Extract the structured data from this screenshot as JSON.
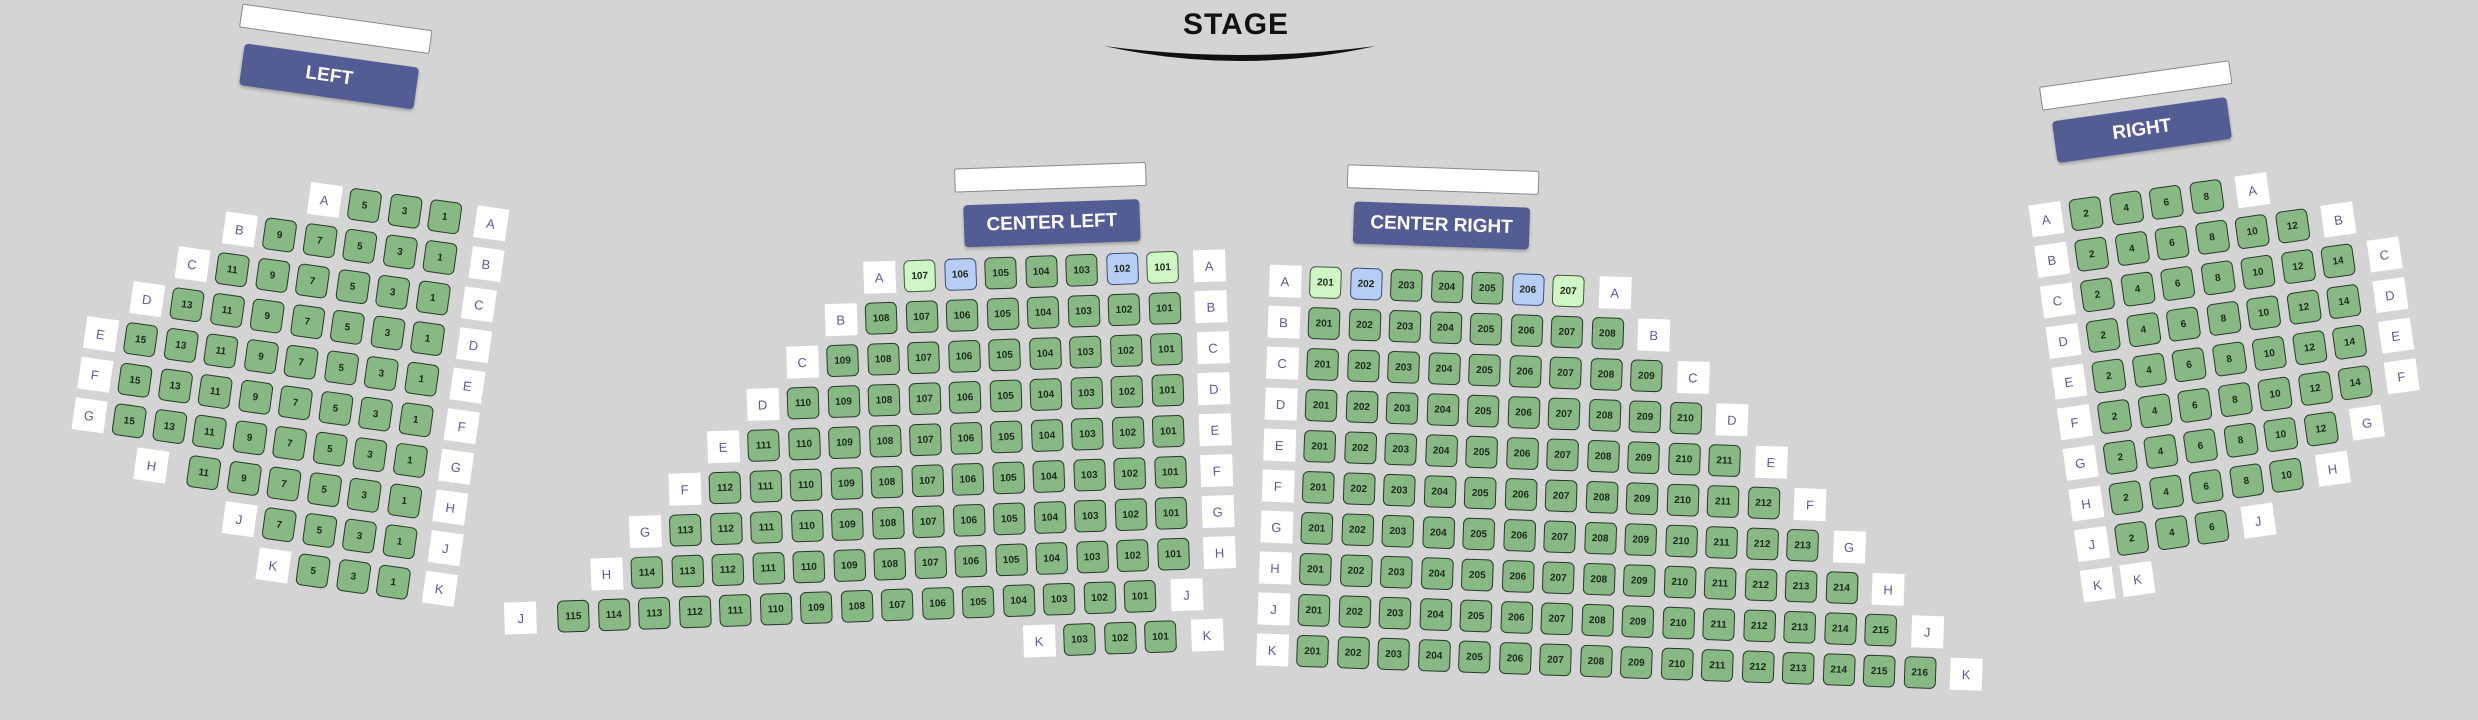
{
  "stage": {
    "title": "STAGE"
  },
  "colors": {
    "background": "#d4d4d4",
    "seat_available": "#88b984",
    "seat_selected": "#b7cdf3",
    "seat_held": "#cff6c4",
    "banner": "#545c94",
    "row_label_text": "#5b5b9b"
  },
  "seat_legend_states": [
    "available",
    "selected",
    "held"
  ],
  "sections": [
    {
      "id": "left",
      "name": "LEFT",
      "rows": [
        {
          "label": "A",
          "seats": [
            "5",
            "3",
            "1"
          ]
        },
        {
          "label": "B",
          "seats": [
            "9",
            "7",
            "5",
            "3",
            "1"
          ]
        },
        {
          "label": "C",
          "seats": [
            "11",
            "9",
            "7",
            "5",
            "3",
            "1"
          ]
        },
        {
          "label": "D",
          "seats": [
            "13",
            "11",
            "9",
            "7",
            "5",
            "3",
            "1"
          ]
        },
        {
          "label": "E",
          "seats": [
            "15",
            "13",
            "11",
            "9",
            "7",
            "5",
            "3",
            "1"
          ]
        },
        {
          "label": "F",
          "seats": [
            "15",
            "13",
            "11",
            "9",
            "7",
            "5",
            "3",
            "1"
          ]
        },
        {
          "label": "G",
          "seats": [
            "15",
            "13",
            "11",
            "9",
            "7",
            "5",
            "3",
            "1"
          ]
        },
        {
          "label": "H",
          "seats": [
            "11",
            "9",
            "7",
            "5",
            "3",
            "1"
          ]
        },
        {
          "label": "J",
          "seats": [
            "7",
            "5",
            "3",
            "1"
          ]
        },
        {
          "label": "K",
          "seats": [
            "5",
            "3",
            "1"
          ]
        }
      ]
    },
    {
      "id": "center-left",
      "name": "CENTER LEFT",
      "rows": [
        {
          "label": "A",
          "seats": [
            "107",
            "106",
            "105",
            "104",
            "103",
            "102",
            "101"
          ],
          "states": {
            "107": "held",
            "106": "selected",
            "102": "selected",
            "101": "held"
          }
        },
        {
          "label": "B",
          "seats": [
            "108",
            "107",
            "106",
            "105",
            "104",
            "103",
            "102",
            "101"
          ]
        },
        {
          "label": "C",
          "seats": [
            "109",
            "108",
            "107",
            "106",
            "105",
            "104",
            "103",
            "102",
            "101"
          ]
        },
        {
          "label": "D",
          "seats": [
            "110",
            "109",
            "108",
            "107",
            "106",
            "105",
            "104",
            "103",
            "102",
            "101"
          ]
        },
        {
          "label": "E",
          "seats": [
            "111",
            "110",
            "109",
            "108",
            "107",
            "106",
            "105",
            "104",
            "103",
            "102",
            "101"
          ]
        },
        {
          "label": "F",
          "seats": [
            "112",
            "111",
            "110",
            "109",
            "108",
            "107",
            "106",
            "105",
            "104",
            "103",
            "102",
            "101"
          ]
        },
        {
          "label": "G",
          "seats": [
            "113",
            "112",
            "111",
            "110",
            "109",
            "108",
            "107",
            "106",
            "105",
            "104",
            "103",
            "102",
            "101"
          ]
        },
        {
          "label": "H",
          "seats": [
            "114",
            "113",
            "112",
            "111",
            "110",
            "109",
            "108",
            "107",
            "106",
            "105",
            "104",
            "103",
            "102",
            "101"
          ]
        },
        {
          "label": "J",
          "seats": [
            "115",
            "114",
            "113",
            "112",
            "111",
            "110",
            "109",
            "108",
            "107",
            "106",
            "105",
            "104",
            "103",
            "102",
            "101"
          ]
        },
        {
          "label": "K",
          "seats": [
            "103",
            "102",
            "101"
          ]
        }
      ]
    },
    {
      "id": "center-right",
      "name": "CENTER RIGHT",
      "rows": [
        {
          "label": "A",
          "seats": [
            "201",
            "202",
            "203",
            "204",
            "205",
            "206",
            "207"
          ],
          "states": {
            "201": "held",
            "202": "selected",
            "206": "selected",
            "207": "held"
          }
        },
        {
          "label": "B",
          "seats": [
            "201",
            "202",
            "203",
            "204",
            "205",
            "206",
            "207",
            "208"
          ]
        },
        {
          "label": "C",
          "seats": [
            "201",
            "202",
            "203",
            "204",
            "205",
            "206",
            "207",
            "208",
            "209"
          ]
        },
        {
          "label": "D",
          "seats": [
            "201",
            "202",
            "203",
            "204",
            "205",
            "206",
            "207",
            "208",
            "209",
            "210"
          ]
        },
        {
          "label": "E",
          "seats": [
            "201",
            "202",
            "203",
            "204",
            "205",
            "206",
            "207",
            "208",
            "209",
            "210",
            "211"
          ]
        },
        {
          "label": "F",
          "seats": [
            "201",
            "202",
            "203",
            "204",
            "205",
            "206",
            "207",
            "208",
            "209",
            "210",
            "211",
            "212"
          ]
        },
        {
          "label": "G",
          "seats": [
            "201",
            "202",
            "203",
            "204",
            "205",
            "206",
            "207",
            "208",
            "209",
            "210",
            "211",
            "212",
            "213"
          ]
        },
        {
          "label": "H",
          "seats": [
            "201",
            "202",
            "203",
            "204",
            "205",
            "206",
            "207",
            "208",
            "209",
            "210",
            "211",
            "212",
            "213",
            "214"
          ]
        },
        {
          "label": "J",
          "seats": [
            "201",
            "202",
            "203",
            "204",
            "205",
            "206",
            "207",
            "208",
            "209",
            "210",
            "211",
            "212",
            "213",
            "214",
            "215"
          ]
        },
        {
          "label": "K",
          "seats": [
            "201",
            "202",
            "203",
            "204",
            "205",
            "206",
            "207",
            "208",
            "209",
            "210",
            "211",
            "212",
            "213",
            "214",
            "215",
            "216"
          ]
        }
      ]
    },
    {
      "id": "right",
      "name": "RIGHT",
      "rows": [
        {
          "label": "A",
          "seats": [
            "2",
            "4",
            "6",
            "8"
          ]
        },
        {
          "label": "B",
          "seats": [
            "2",
            "4",
            "6",
            "8",
            "10",
            "12"
          ]
        },
        {
          "label": "C",
          "seats": [
            "2",
            "4",
            "6",
            "8",
            "10",
            "12",
            "14"
          ]
        },
        {
          "label": "D",
          "seats": [
            "2",
            "4",
            "6",
            "8",
            "10",
            "12",
            "14"
          ]
        },
        {
          "label": "E",
          "seats": [
            "2",
            "4",
            "6",
            "8",
            "10",
            "12",
            "14"
          ]
        },
        {
          "label": "F",
          "seats": [
            "2",
            "4",
            "6",
            "8",
            "10",
            "12",
            "14"
          ]
        },
        {
          "label": "G",
          "seats": [
            "2",
            "4",
            "6",
            "8",
            "10",
            "12"
          ]
        },
        {
          "label": "H",
          "seats": [
            "2",
            "4",
            "6",
            "8",
            "10"
          ]
        },
        {
          "label": "J",
          "seats": [
            "2",
            "4",
            "6"
          ]
        },
        {
          "label": "K",
          "seats": []
        }
      ]
    }
  ]
}
